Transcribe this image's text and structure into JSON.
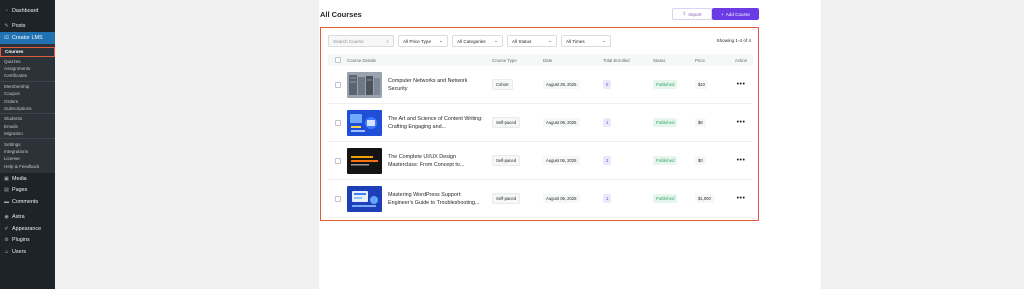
{
  "sidebar": {
    "top": [
      {
        "label": "Dashboard",
        "icon": "dashboard-icon"
      },
      {
        "label": "Posts",
        "icon": "pin-icon"
      },
      {
        "label": "Creator LMS",
        "icon": "lms-icon"
      }
    ],
    "submenu": [
      {
        "label": "Courses",
        "current": true
      },
      {
        "label": "Quizzes"
      },
      {
        "label": "Assignments"
      },
      {
        "label": "Certificates"
      },
      {
        "sep": true
      },
      {
        "label": "Membership"
      },
      {
        "label": "Coupon"
      },
      {
        "label": "Orders"
      },
      {
        "label": "Subscriptions"
      },
      {
        "sep": true
      },
      {
        "label": "Students"
      },
      {
        "label": "Emails"
      },
      {
        "label": "Migration"
      },
      {
        "sep": true
      },
      {
        "label": "Settings"
      },
      {
        "label": "Integrations"
      },
      {
        "label": "License"
      },
      {
        "label": "Help & Feedback"
      }
    ],
    "bottom": [
      {
        "label": "Media",
        "icon": "media-icon"
      },
      {
        "label": "Pages",
        "icon": "pages-icon"
      },
      {
        "label": "Comments",
        "icon": "comments-icon"
      },
      {
        "label": "Astra",
        "icon": "astra-icon"
      },
      {
        "label": "Appearance",
        "icon": "appearance-icon"
      },
      {
        "label": "Plugins",
        "icon": "plugins-icon"
      },
      {
        "label": "Users",
        "icon": "users-icon"
      }
    ]
  },
  "page": {
    "title": "All Courses",
    "import_label": "Import",
    "add_label": "Add Course"
  },
  "filters": {
    "search_placeholder": "Search Course",
    "price_type": "All Price Type",
    "categories": "All Categories",
    "status": "All Status",
    "times": "All Times",
    "showing": "Showing 1-4 of 4"
  },
  "table": {
    "headers": {
      "course": "Course Details",
      "type": "Course Type",
      "date": "Date",
      "enrolled": "Total Enrolled",
      "status": "Status",
      "price": "Price",
      "action": "Action"
    },
    "rows": [
      {
        "title": "Computer Networks and Network Security",
        "type": "Cohort",
        "date": "August 29, 2025",
        "enrolled": "0",
        "status": "Published",
        "price": "$10",
        "action": "•••",
        "thumb": "network-photo"
      },
      {
        "title": "The Art and Science of Content Writing: Crafting Engaging and...",
        "type": "Self-paced",
        "date": "August 06, 2025",
        "enrolled": "1",
        "status": "Published",
        "price": "$8",
        "action": "•••",
        "thumb": "content-writing-art"
      },
      {
        "title": "The Complete UI/UX Design Masterclass: From Concept to...",
        "type": "Self-paced",
        "date": "August 06, 2025",
        "enrolled": "2",
        "status": "Published",
        "price": "$0",
        "action": "•••",
        "thumb": "uiux-design-art"
      },
      {
        "title": "Mastering WordPress Support: Engineer's Guide to Troubleshooting...",
        "type": "Self-paced",
        "date": "August 06, 2025",
        "enrolled": "1",
        "status": "Published",
        "price": "$1,000",
        "action": "•••",
        "thumb": "wordpress-support-art"
      }
    ]
  },
  "colors": {
    "accent": "#6b3ce6",
    "highlight_border": "#e35a3f",
    "sidebar_bg": "#1d2327",
    "published_text": "#2fa56b"
  }
}
